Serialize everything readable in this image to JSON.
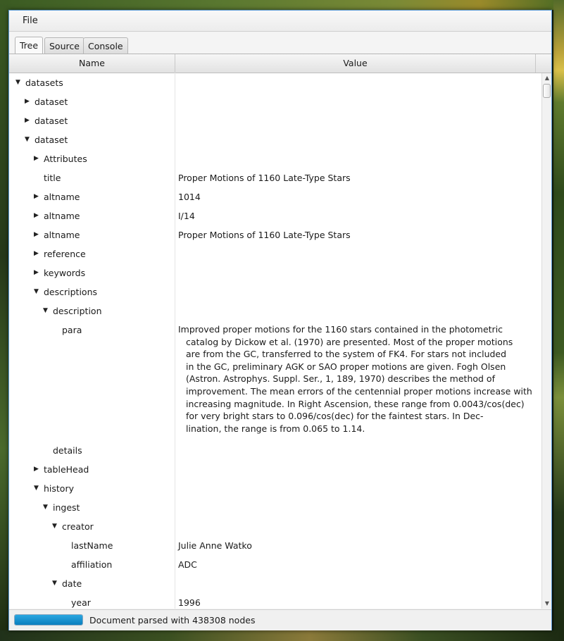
{
  "menu": {
    "file_label": "File"
  },
  "tabs": [
    {
      "label": "Tree",
      "active": true
    },
    {
      "label": "Source",
      "active": false
    },
    {
      "label": "Console",
      "active": false
    }
  ],
  "table": {
    "columns": {
      "name": "Name",
      "value": "Value"
    },
    "rows": [
      {
        "name": "datasets",
        "level": 0,
        "toggle": "expanded",
        "value": ""
      },
      {
        "name": "dataset",
        "level": 1,
        "toggle": "collapsed",
        "value": ""
      },
      {
        "name": "dataset",
        "level": 1,
        "toggle": "collapsed",
        "value": ""
      },
      {
        "name": "dataset",
        "level": 1,
        "toggle": "expanded",
        "value": ""
      },
      {
        "name": "Attributes",
        "level": 2,
        "toggle": "collapsed",
        "value": ""
      },
      {
        "name": "title",
        "level": 2,
        "toggle": "none",
        "value": "Proper Motions of 1160 Late-Type Stars"
      },
      {
        "name": "altname",
        "level": 2,
        "toggle": "collapsed",
        "value": "1014"
      },
      {
        "name": "altname",
        "level": 2,
        "toggle": "collapsed",
        "value": "I/14"
      },
      {
        "name": "altname",
        "level": 2,
        "toggle": "collapsed",
        "value": "Proper Motions of 1160 Late-Type Stars"
      },
      {
        "name": "reference",
        "level": 2,
        "toggle": "collapsed",
        "value": ""
      },
      {
        "name": "keywords",
        "level": 2,
        "toggle": "collapsed",
        "value": ""
      },
      {
        "name": "descriptions",
        "level": 2,
        "toggle": "expanded",
        "value": ""
      },
      {
        "name": "description",
        "level": 3,
        "toggle": "expanded",
        "value": ""
      },
      {
        "name": "para",
        "level": 4,
        "toggle": "none",
        "value_lines": [
          "Improved proper motions for the 1160 stars contained in the photometric",
          "catalog by Dickow et al. (1970) are presented. Most of the proper motions",
          "are from the GC, transferred to the system of FK4. For stars not included",
          "in the GC, preliminary AGK or SAO proper motions are given. Fogh Olsen",
          "(Astron. Astrophys. Suppl. Ser., 1, 189, 1970) describes the method of",
          "improvement. The mean errors of the centennial proper motions increase with",
          "increasing magnitude. In Right Ascension, these range from 0.0043/cos(dec)",
          "for very bright stars to 0.096/cos(dec) for the faintest stars. In Dec-",
          "lination, the range is from 0.065 to 1.14."
        ]
      },
      {
        "name": "details",
        "level": 3,
        "toggle": "none",
        "value": ""
      },
      {
        "name": "tableHead",
        "level": 2,
        "toggle": "collapsed",
        "value": ""
      },
      {
        "name": "history",
        "level": 2,
        "toggle": "expanded",
        "value": ""
      },
      {
        "name": "ingest",
        "level": 3,
        "toggle": "expanded",
        "value": ""
      },
      {
        "name": "creator",
        "level": 4,
        "toggle": "expanded",
        "value": ""
      },
      {
        "name": "lastName",
        "level": 5,
        "toggle": "none",
        "value": "Julie Anne Watko"
      },
      {
        "name": "affiliation",
        "level": 5,
        "toggle": "none",
        "value": "ADC"
      },
      {
        "name": "date",
        "level": 4,
        "toggle": "expanded",
        "value": ""
      },
      {
        "name": "year",
        "level": 5,
        "toggle": "none",
        "value": "1996"
      }
    ]
  },
  "status": {
    "progress": 1.0,
    "text": "Document parsed with 438308 nodes"
  },
  "colors": {
    "accent": "#1a8fd0",
    "window_border": "#5b9bd5"
  },
  "icons": {
    "expanded": "triangle-down-icon",
    "collapsed": "triangle-right-icon"
  }
}
